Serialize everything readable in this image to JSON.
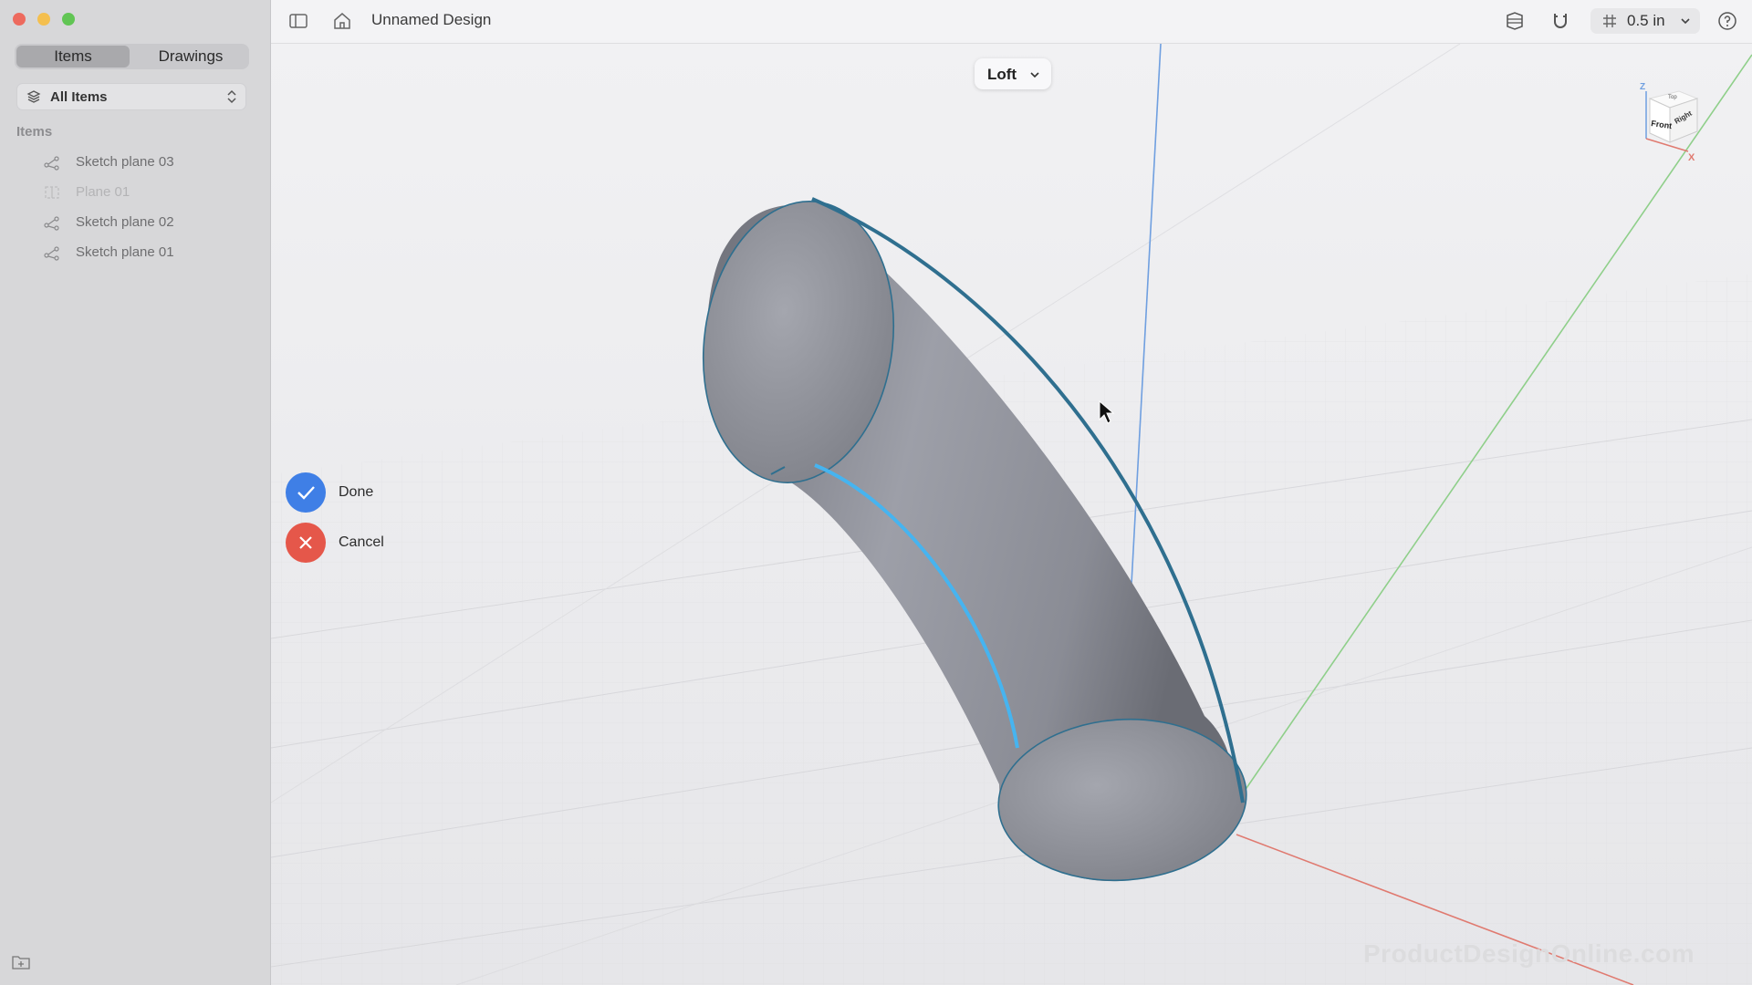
{
  "window": {
    "title": "Unnamed Design"
  },
  "sidebar": {
    "tabs": {
      "items": "Items",
      "drawings": "Drawings"
    },
    "filter": {
      "label": "All Items"
    },
    "section_heading": "Items",
    "tree": [
      {
        "label": "Sketch plane 03",
        "icon": "sketch-plane-icon"
      },
      {
        "label": "Plane 01",
        "icon": "plane-icon"
      },
      {
        "label": "Sketch plane 02",
        "icon": "sketch-plane-icon"
      },
      {
        "label": "Sketch plane 01",
        "icon": "sketch-plane-icon"
      }
    ]
  },
  "toolbar": {
    "icons": [
      "sidebar-toggle-icon",
      "home-icon",
      "render-mode-icon",
      "snap-magnet-icon",
      "grid-icon",
      "help-icon"
    ],
    "grid_size": "0.5 in"
  },
  "viewport": {
    "operation": "Loft",
    "actions": {
      "done": "Done",
      "cancel": "Cancel"
    },
    "view_cube": {
      "front": "Front",
      "right": "Right",
      "top": "Top",
      "z_axis": "Z",
      "x_axis": "X"
    },
    "watermark": "ProductDesignOnline.com"
  },
  "colors": {
    "accent_blue": "#3f7fe6",
    "cancel_red": "#e5574a",
    "selection_blue": "#46b4f0",
    "edge_teal": "#2f6f8f",
    "x_axis": "#e07a70",
    "y_axis": "#8fcf8a",
    "z_axis": "#6f9fe0"
  }
}
